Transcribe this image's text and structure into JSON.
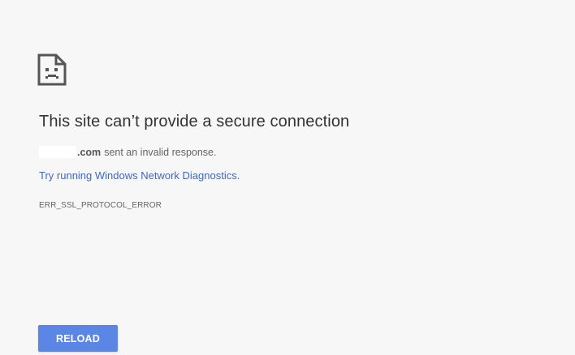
{
  "error_page": {
    "icon": "sad-page-icon",
    "title": "This site can’t provide a secure connection",
    "detail": {
      "domain": ".com",
      "message": "sent an invalid response."
    },
    "diagnostics_link": "Try running Windows Network Diagnostics.",
    "error_code": "ERR_SSL_PROTOCOL_ERROR",
    "reload_label": "RELOAD"
  },
  "colors": {
    "background": "#f7f7f7",
    "link": "#3f67c4",
    "button": "#5c86e6",
    "title_text": "#333333",
    "secondary_text": "#646464"
  }
}
